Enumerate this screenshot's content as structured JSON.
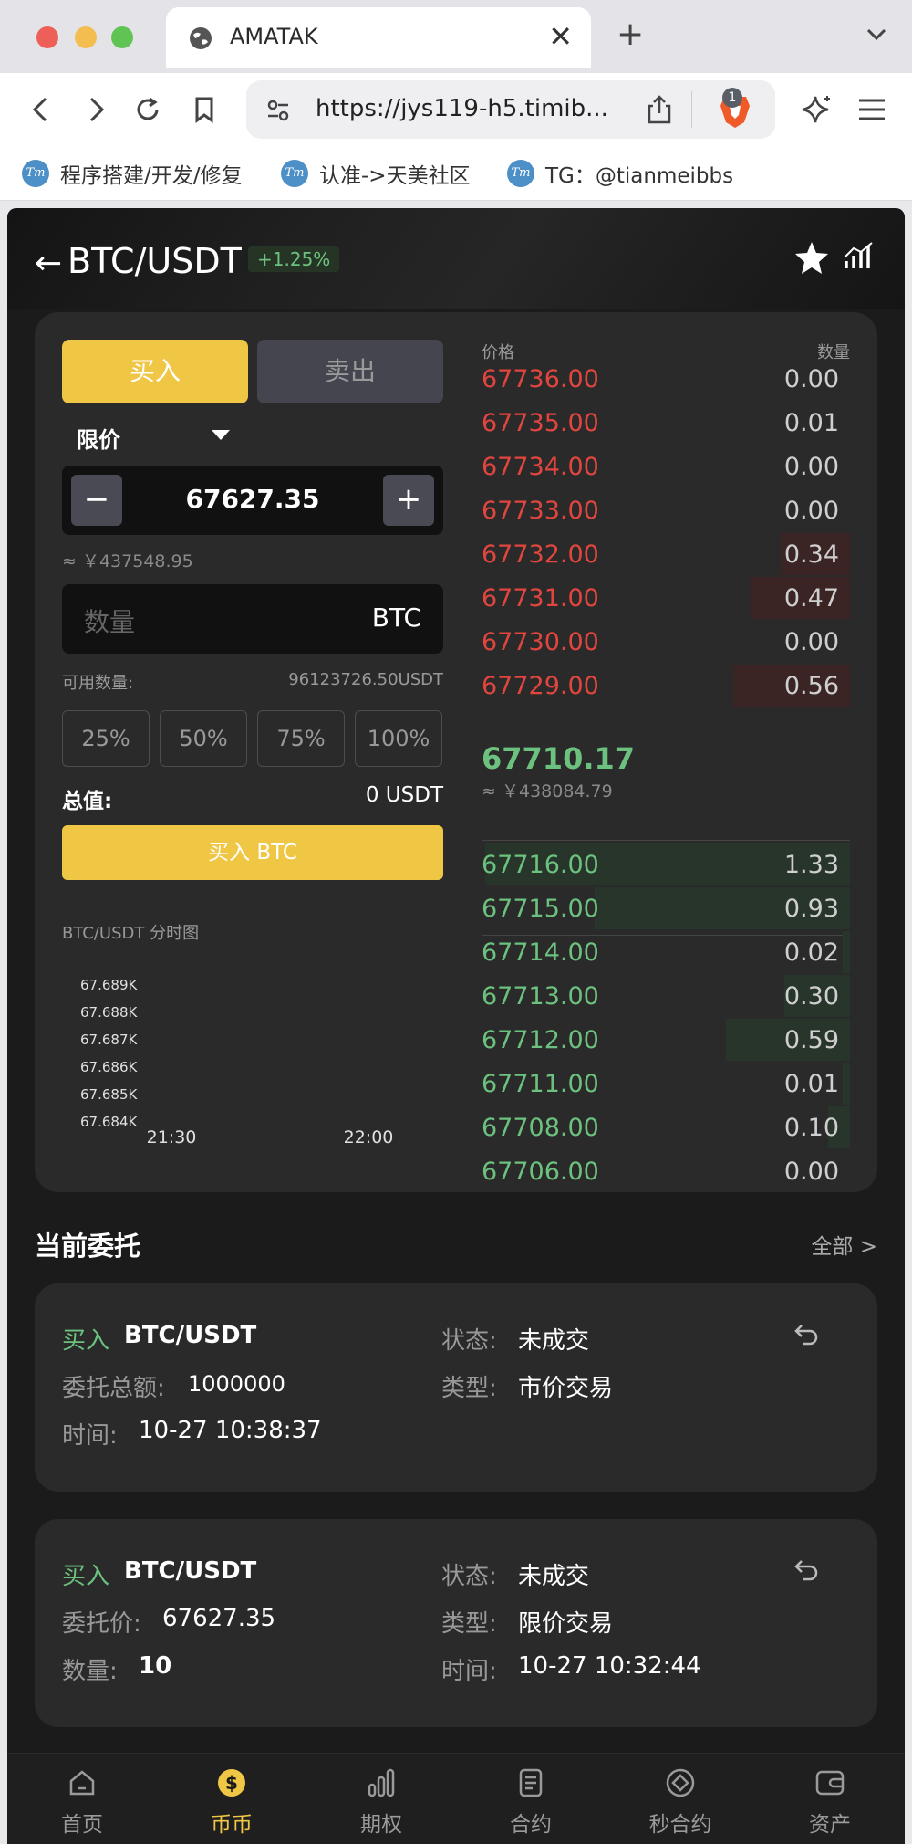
{
  "browser": {
    "tab_title": "AMATAK",
    "url": "https://jys119-h5.timib...",
    "shield_badge": "1",
    "bookmarks": [
      {
        "icon_text": "Tm",
        "label": "程序搭建/开发/修复"
      },
      {
        "icon_text": "Tm",
        "label": "认准->天美社区"
      },
      {
        "icon_text": "Tm",
        "label": "TG：@tianmeibbs"
      }
    ]
  },
  "header": {
    "back_glyph": "←",
    "pair": "BTC/USDT",
    "change": "+1.25%"
  },
  "trade": {
    "buy_tab": "买入",
    "sell_tab": "卖出",
    "order_type": "限价",
    "minus": "−",
    "plus": "+",
    "price": "67627.35",
    "price_cny": "≈ ￥437548.95",
    "qty_placeholder": "数量",
    "qty_unit": "BTC",
    "available_label": "可用数量:",
    "available_value": "96123726.50USDT",
    "percents": [
      "25%",
      "50%",
      "75%",
      "100%"
    ],
    "total_label": "总值:",
    "total_value": "0 USDT",
    "submit": "买入 BTC",
    "mini_chart_title": "BTC/USDT 分时图"
  },
  "chart_data": {
    "type": "line",
    "title": "BTC/USDT 分时图",
    "y_ticks": [
      "67.689K",
      "67.688K",
      "67.687K",
      "67.686K",
      "67.685K",
      "67.684K"
    ],
    "x_ticks": [
      "21:30",
      "22:00"
    ],
    "ylim": [
      67684,
      67689
    ],
    "series": []
  },
  "orderbook": {
    "price_header": "价格",
    "qty_header": "数量",
    "asks": [
      {
        "price": "67736.00",
        "qty": "0.00",
        "depth": 0
      },
      {
        "price": "67735.00",
        "qty": "0.01",
        "depth": 0
      },
      {
        "price": "67734.00",
        "qty": "0.00",
        "depth": 0
      },
      {
        "price": "67733.00",
        "qty": "0.00",
        "depth": 0
      },
      {
        "price": "67732.00",
        "qty": "0.34",
        "depth": 0.19
      },
      {
        "price": "67731.00",
        "qty": "0.47",
        "depth": 0.27
      },
      {
        "price": "67730.00",
        "qty": "0.00",
        "depth": 0
      },
      {
        "price": "67729.00",
        "qty": "0.56",
        "depth": 0.32
      }
    ],
    "last_price": "67710.17",
    "last_cny": "≈ ￥438084.79",
    "bids": [
      {
        "price": "67716.00",
        "qty": "1.33",
        "depth": 1.0
      },
      {
        "price": "67715.00",
        "qty": "0.93",
        "depth": 0.7
      },
      {
        "price": "67714.00",
        "qty": "0.02",
        "depth": 0.02
      },
      {
        "price": "67713.00",
        "qty": "0.30",
        "depth": 0.18
      },
      {
        "price": "67712.00",
        "qty": "0.59",
        "depth": 0.34
      },
      {
        "price": "67711.00",
        "qty": "0.01",
        "depth": 0.02
      },
      {
        "price": "67708.00",
        "qty": "0.10",
        "depth": 0.06
      },
      {
        "price": "67706.00",
        "qty": "0.00",
        "depth": 0
      }
    ],
    "ask_color": "#e0463e",
    "bid_color": "#6cc17e"
  },
  "orders_section": {
    "title": "当前委托",
    "more": "全部 >",
    "orders": [
      {
        "side": "买入",
        "pair": "BTC/USDT",
        "left2_label": "委托总额:",
        "left2_value": "1000000",
        "left3_label": "时间:",
        "left3_value": "10-27 10:38:37",
        "right1_label": "状态:",
        "right1_value": "未成交",
        "right2_label": "类型:",
        "right2_value": "市价交易",
        "right3_label": "",
        "right3_value": ""
      },
      {
        "side": "买入",
        "pair": "BTC/USDT",
        "left2_label": "委托价:",
        "left2_value": "67627.35",
        "left3_label": "数量:",
        "left3_value": "10",
        "right1_label": "状态:",
        "right1_value": "未成交",
        "right2_label": "类型:",
        "right2_value": "限价交易",
        "right3_label": "时间:",
        "right3_value": "10-27 10:32:44"
      }
    ]
  },
  "tabbar": {
    "items": [
      {
        "label": "首页",
        "icon": "home-icon"
      },
      {
        "label": "币币",
        "icon": "coin-icon"
      },
      {
        "label": "期权",
        "icon": "bars-icon"
      },
      {
        "label": "合约",
        "icon": "document-icon"
      },
      {
        "label": "秒合约",
        "icon": "target-icon"
      },
      {
        "label": "资产",
        "icon": "wallet-icon"
      }
    ],
    "active_index": 1,
    "active_color": "#f0c745",
    "inactive_color": "#9a9a9a"
  }
}
